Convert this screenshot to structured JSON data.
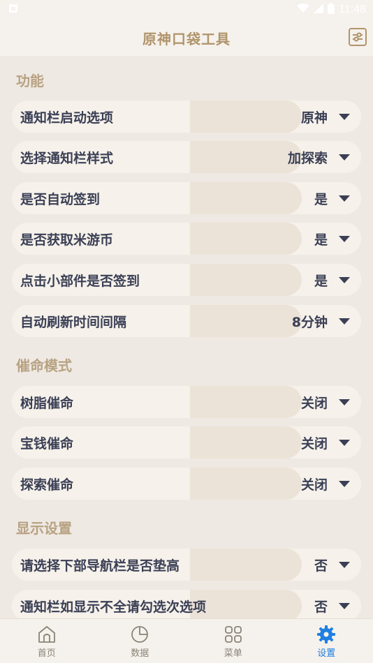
{
  "status": {
    "time": "11:48"
  },
  "appbar": {
    "title": "原神口袋工具"
  },
  "sections": [
    {
      "title": "功能",
      "rows": [
        {
          "label": "通知栏启动选项",
          "value": "原神"
        },
        {
          "label": "选择通知栏样式",
          "value": "加探索"
        },
        {
          "label": "是否自动签到",
          "value": "是"
        },
        {
          "label": "是否获取米游币",
          "value": "是"
        },
        {
          "label": "点击小部件是否签到",
          "value": "是"
        },
        {
          "label": "自动刷新时间间隔",
          "value": "8分钟"
        }
      ]
    },
    {
      "title": "催命模式",
      "rows": [
        {
          "label": "树脂催命",
          "value": "关闭"
        },
        {
          "label": "宝钱催命",
          "value": "关闭"
        },
        {
          "label": "探索催命",
          "value": "关闭"
        }
      ]
    },
    {
      "title": "显示设置",
      "rows": [
        {
          "label": "请选择下部导航栏是否垫高",
          "value": "否"
        },
        {
          "label": "通知栏如显示不全请勾选次选项",
          "value": "否"
        }
      ]
    }
  ],
  "bottom_nav": {
    "items": [
      {
        "label": "首页",
        "icon": "home-icon"
      },
      {
        "label": "数据",
        "icon": "pie-chart-icon"
      },
      {
        "label": "菜单",
        "icon": "grid-icon"
      },
      {
        "label": "设置",
        "icon": "gear-icon",
        "active": true
      }
    ]
  },
  "colors": {
    "background": "#efe9e3",
    "accent_gold": "#b0946a",
    "section_title": "#b7a282",
    "text": "#3a3f55",
    "active_nav": "#1e7fe0"
  }
}
